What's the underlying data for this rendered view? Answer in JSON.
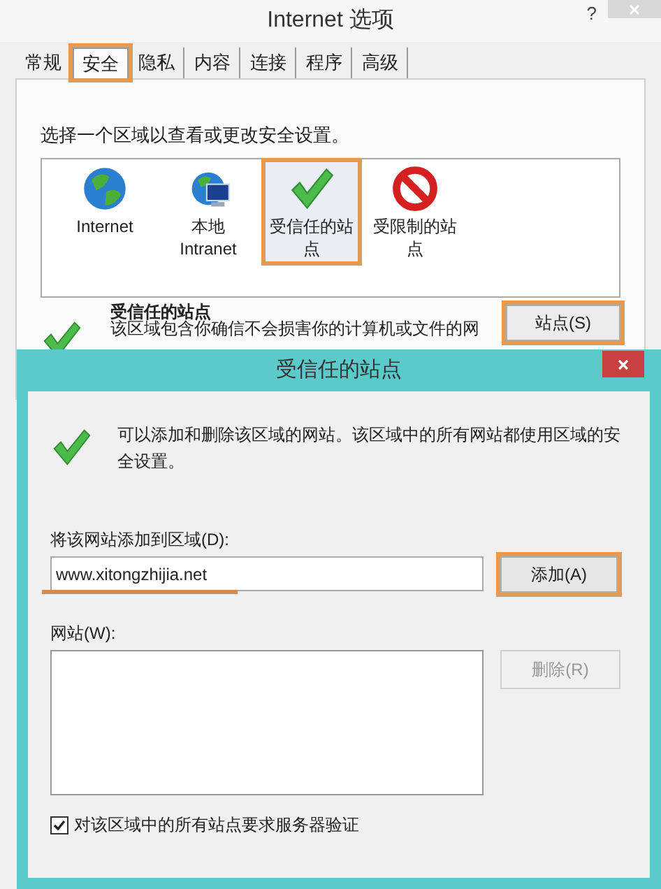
{
  "window": {
    "title": "Internet 选项",
    "help": "?"
  },
  "tabs": [
    {
      "label": "常规",
      "selected": false,
      "highlighted": false
    },
    {
      "label": "安全",
      "selected": true,
      "highlighted": true
    },
    {
      "label": "隐私",
      "selected": false,
      "highlighted": false
    },
    {
      "label": "内容",
      "selected": false,
      "highlighted": false
    },
    {
      "label": "连接",
      "selected": false,
      "highlighted": false
    },
    {
      "label": "程序",
      "selected": false,
      "highlighted": false
    },
    {
      "label": "高级",
      "selected": false,
      "highlighted": false
    }
  ],
  "prompt": "选择一个区域以查看或更改安全设置。",
  "zones": [
    {
      "kind": "internet",
      "label": "Internet",
      "selected": false,
      "highlighted": false
    },
    {
      "kind": "intranet",
      "label": "本地 Intranet",
      "selected": false,
      "highlighted": false
    },
    {
      "kind": "trusted",
      "label": "受信任的站点",
      "selected": true,
      "highlighted": true
    },
    {
      "kind": "restricted",
      "label": "受限制的站点",
      "selected": false,
      "highlighted": false
    }
  ],
  "zone_info": {
    "kind": "trusted",
    "title": "受信任的站点",
    "description": "该区域包含你确信不会损害你的计算机或文件的网"
  },
  "sites_button": {
    "label": "站点(S)",
    "highlighted": true
  },
  "dialog": {
    "title": "受信任的站点",
    "info": "可以添加和删除该区域的网站。该区域中的所有网站都使用区域的安全设置。",
    "add_label": "将该网站添加到区域(D):",
    "url": "www.xitongzhijia.net",
    "url_underlined": true,
    "add_button": {
      "label": "添加(A)",
      "highlighted": true
    },
    "sites_label": "网站(W):",
    "remove_button": {
      "label": "删除(R)",
      "disabled": true
    },
    "require_verification": {
      "label": "对该区域中的所有站点要求服务器验证",
      "checked": true
    }
  }
}
